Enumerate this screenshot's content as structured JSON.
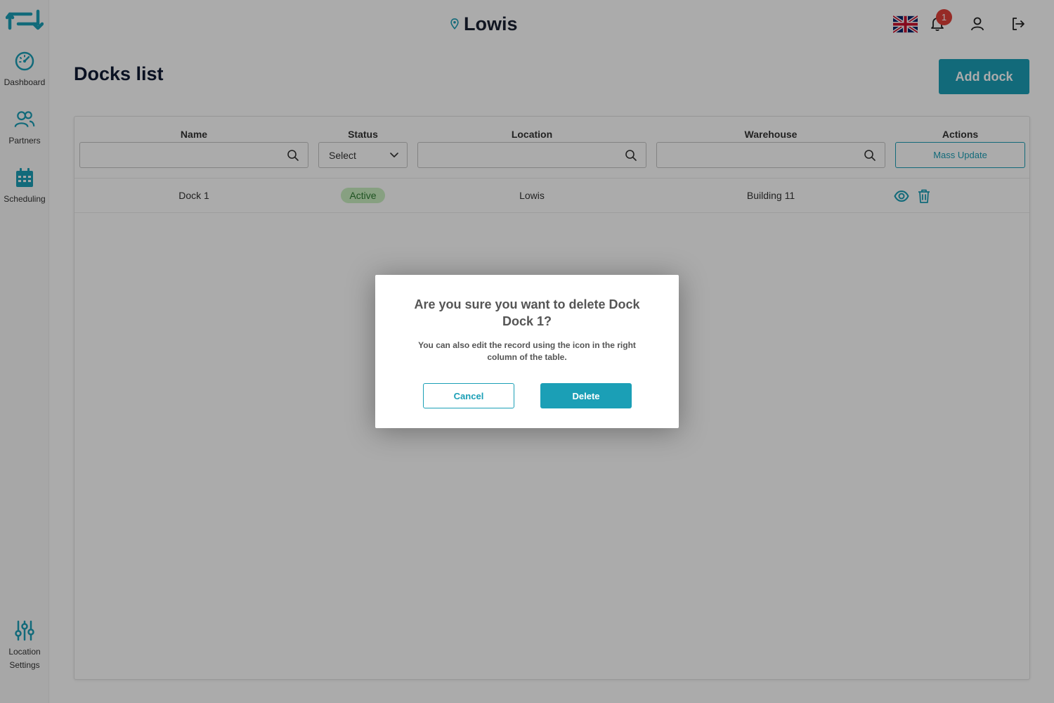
{
  "colors": {
    "accent": "#1b9fb6",
    "badge": "#e0413a",
    "active_bg": "#c9efc0",
    "active_text": "#2e7d32"
  },
  "sidebar": {
    "items": [
      {
        "label": "Dashboard",
        "icon": "dashboard-gauge-icon"
      },
      {
        "label": "Partners",
        "icon": "partners-users-icon"
      },
      {
        "label": "Scheduling",
        "icon": "calendar-icon"
      }
    ],
    "settings": {
      "label_line1": "Location",
      "label_line2": "Settings",
      "icon": "sliders-icon"
    }
  },
  "header": {
    "location": "Lowis",
    "notification_count": "1",
    "icons": [
      "uk-flag-icon",
      "bell-icon",
      "user-icon",
      "logout-icon"
    ]
  },
  "page": {
    "title": "Docks list",
    "add_button": "Add dock"
  },
  "table": {
    "columns": {
      "name": "Name",
      "status": "Status",
      "location": "Location",
      "warehouse": "Warehouse",
      "actions": "Actions"
    },
    "filters": {
      "status_select": "Select",
      "mass_update": "Mass Update"
    },
    "rows": [
      {
        "name": "Dock 1",
        "status": "Active",
        "location": "Lowis",
        "warehouse": "Building 11"
      }
    ]
  },
  "modal": {
    "title": "Are you sure you want to delete Dock Dock 1?",
    "text": "You can also edit the record using the icon in the right column of the table.",
    "cancel": "Cancel",
    "delete": "Delete"
  }
}
